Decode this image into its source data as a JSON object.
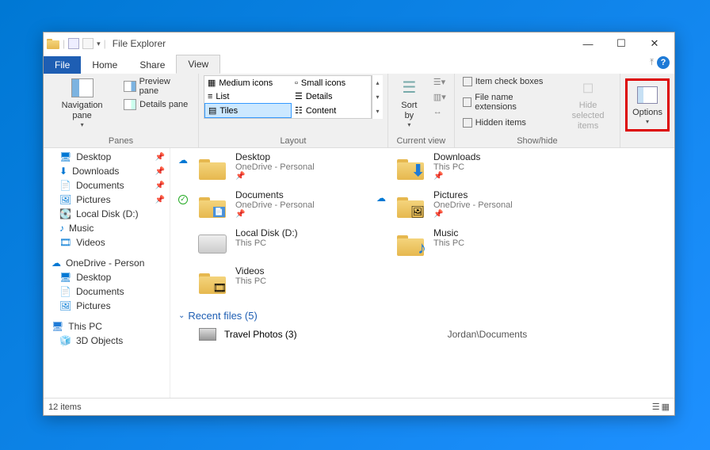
{
  "window": {
    "title": "File Explorer",
    "minimize": "—",
    "maximize": "☐",
    "close": "✕"
  },
  "tabs": {
    "file": "File",
    "home": "Home",
    "share": "Share",
    "view": "View"
  },
  "ribbon": {
    "panes": {
      "navigation": "Navigation pane",
      "preview": "Preview pane",
      "details": "Details pane",
      "label": "Panes"
    },
    "layout": {
      "medium": "Medium icons",
      "small": "Small icons",
      "list": "List",
      "details": "Details",
      "tiles": "Tiles",
      "content": "Content",
      "label": "Layout"
    },
    "current": {
      "sort": "Sort by",
      "label": "Current view"
    },
    "showhide": {
      "check": "Item check boxes",
      "ext": "File name extensions",
      "hidden": "Hidden items",
      "hide": "Hide selected items",
      "label": "Show/hide"
    },
    "options": "Options"
  },
  "sidebar": {
    "items": [
      {
        "label": "Desktop",
        "pin": true
      },
      {
        "label": "Downloads",
        "pin": true
      },
      {
        "label": "Documents",
        "pin": true
      },
      {
        "label": "Pictures",
        "pin": true
      },
      {
        "label": "Local Disk (D:)"
      },
      {
        "label": "Music"
      },
      {
        "label": "Videos"
      }
    ],
    "onedrive": "OneDrive - Person",
    "od_items": [
      {
        "label": "Desktop"
      },
      {
        "label": "Documents"
      },
      {
        "label": "Pictures"
      }
    ],
    "thispc": "This PC",
    "pc_items": [
      {
        "label": "3D Objects"
      }
    ]
  },
  "tiles": [
    {
      "name": "Desktop",
      "sub": "OneDrive - Personal",
      "pin": true,
      "status": "cloud"
    },
    {
      "name": "Downloads",
      "sub": "This PC",
      "pin": true,
      "icon": "down"
    },
    {
      "name": "Documents",
      "sub": "OneDrive - Personal",
      "pin": true,
      "status": "check",
      "icon": "doc"
    },
    {
      "name": "Pictures",
      "sub": "OneDrive - Personal",
      "pin": true,
      "status": "cloud",
      "icon": "pic"
    },
    {
      "name": "Local Disk (D:)",
      "sub": "This PC",
      "icon": "disk"
    },
    {
      "name": "Music",
      "sub": "This PC",
      "icon": "music"
    },
    {
      "name": "Videos",
      "sub": "This PC",
      "icon": "video"
    }
  ],
  "recent": {
    "header": "Recent files (5)",
    "items": [
      {
        "name": "Travel Photos (3)",
        "loc": "Jordan\\Documents"
      }
    ]
  },
  "status": {
    "count": "12 items"
  }
}
